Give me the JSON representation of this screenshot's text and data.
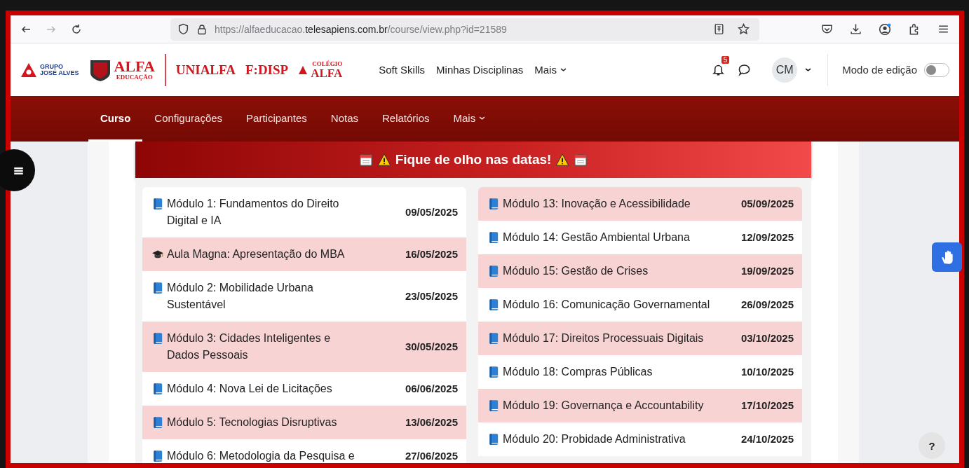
{
  "browser": {
    "url": "https://alfaeducacao.**telesapiens.com.br**/course/view.php?id=21589",
    "forward_disabled": true
  },
  "site_header": {
    "logos": [
      {
        "kind": "group",
        "top": "GRUPO",
        "main": "JOSÉ ALVES"
      },
      {
        "kind": "shield",
        "main": "ALFA",
        "bottom": "EDUCAÇÃO"
      },
      {
        "kind": "word",
        "main": "UNIALFA"
      },
      {
        "kind": "word",
        "main": "F:DISP"
      },
      {
        "kind": "triangle",
        "top": "COLÉGIO",
        "main": "ALFA"
      }
    ],
    "links": [
      {
        "label": "Soft Skills",
        "has_menu": false
      },
      {
        "label": "Minhas Disciplinas",
        "has_menu": false
      },
      {
        "label": "Mais",
        "has_menu": true
      }
    ],
    "notification_count": "5",
    "avatar": "CM",
    "edit_mode": {
      "label": "Modo de edição",
      "on": false
    }
  },
  "course_nav": [
    {
      "label": "Curso",
      "selected": true,
      "has_menu": false
    },
    {
      "label": "Configurações",
      "selected": false,
      "has_menu": false
    },
    {
      "label": "Participantes",
      "selected": false,
      "has_menu": false
    },
    {
      "label": "Notas",
      "selected": false,
      "has_menu": false
    },
    {
      "label": "Relatórios",
      "selected": false,
      "has_menu": false
    },
    {
      "label": "Mais",
      "selected": false,
      "has_menu": true
    }
  ],
  "banner": {
    "title": "Fique de olho nas datas!"
  },
  "left_schedule": [
    {
      "kind": "module",
      "title": "Módulo 1: Fundamentos do Direito Digital e IA",
      "date": "09/05/2025",
      "highlighted": false
    },
    {
      "kind": "lecture",
      "title": "Aula Magna: Apresentação do MBA",
      "date": "16/05/2025",
      "highlighted": true
    },
    {
      "kind": "module",
      "title": "Módulo 2: Mobilidade Urbana Sustentável",
      "date": "23/05/2025",
      "highlighted": false
    },
    {
      "kind": "module",
      "title": "Módulo 3: Cidades Inteligentes e Dados Pessoais",
      "date": "30/05/2025",
      "highlighted": true
    },
    {
      "kind": "module",
      "title": "Módulo 4: Nova Lei de Licitações",
      "date": "06/06/2025",
      "highlighted": false
    },
    {
      "kind": "module",
      "title": "Módulo 5: Tecnologias Disruptivas",
      "date": "13/06/2025",
      "highlighted": true
    },
    {
      "kind": "module",
      "title": "Módulo 6: Metodologia da Pesquisa e",
      "date": "27/06/2025",
      "highlighted": false
    }
  ],
  "right_schedule": [
    {
      "kind": "module",
      "title": "Módulo 13: Inovação e Acessibilidade",
      "date": "05/09/2025",
      "highlighted": true
    },
    {
      "kind": "module",
      "title": "Módulo 14: Gestão Ambiental Urbana",
      "date": "12/09/2025",
      "highlighted": false
    },
    {
      "kind": "module",
      "title": "Módulo 15: Gestão de Crises",
      "date": "19/09/2025",
      "highlighted": true
    },
    {
      "kind": "module",
      "title": "Módulo 16: Comunicação Governamental",
      "date": "26/09/2025",
      "highlighted": false
    },
    {
      "kind": "module",
      "title": "Módulo 17: Direitos Processuais Digitais",
      "date": "03/10/2025",
      "highlighted": true
    },
    {
      "kind": "module",
      "title": "Módulo 18: Compras Públicas",
      "date": "10/10/2025",
      "highlighted": false
    },
    {
      "kind": "module",
      "title": "Módulo 19: Governança e Accountability",
      "date": "17/10/2025",
      "highlighted": true
    },
    {
      "kind": "module",
      "title": "Módulo 20: Probidade Administrativa",
      "date": "24/10/2025",
      "highlighted": false
    }
  ],
  "help_label": "?"
}
